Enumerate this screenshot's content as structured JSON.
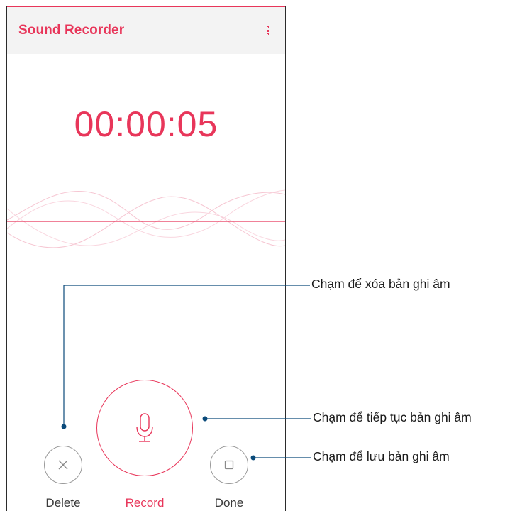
{
  "app": {
    "title": "Sound Recorder",
    "accent_color": "#e8365a",
    "menu_icon": "overflow-menu-icon"
  },
  "recorder": {
    "elapsed_time": "00:00:05",
    "waveform_icon": "waveform-graphic"
  },
  "controls": {
    "delete": {
      "label": "Delete",
      "icon": "close-icon"
    },
    "record": {
      "label": "Record",
      "icon": "microphone-icon"
    },
    "done": {
      "label": "Done",
      "icon": "stop-square-icon"
    }
  },
  "callouts": {
    "delete": "Chạm để xóa bản ghi âm",
    "resume": "Chạm để tiếp tục bản ghi âm",
    "save": "Chạm để lưu bản ghi âm",
    "line_color": "#0a4a7a"
  }
}
